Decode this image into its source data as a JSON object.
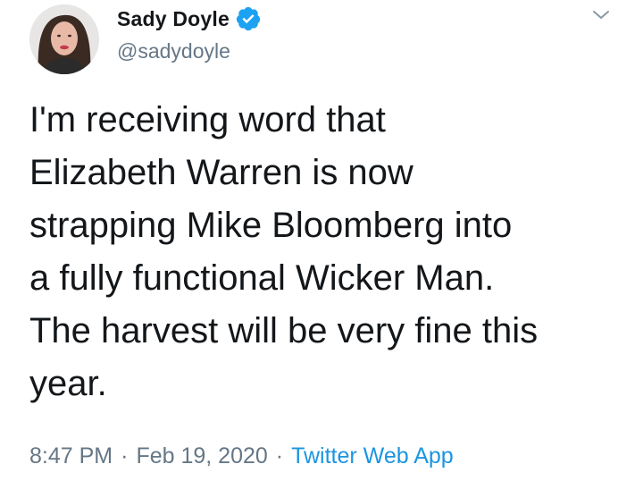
{
  "author": {
    "display_name": "Sady Doyle",
    "handle": "@sadydoyle",
    "verified": true,
    "avatar_icon": "profile-photo"
  },
  "tweet": {
    "text": "I'm receiving word that\nElizabeth Warren is now\nstrapping Mike Bloomberg into\na fully functional Wicker Man.\nThe harvest will be very fine this\nyear."
  },
  "meta": {
    "time": "8:47 PM",
    "separator": "·",
    "date": "Feb 19, 2020",
    "source": "Twitter Web App"
  },
  "icons": {
    "verified": "verified-badge-icon",
    "menu": "chevron-down-icon"
  },
  "colors": {
    "text": "#14171a",
    "secondary": "#657786",
    "accent": "#1b95e0",
    "verified": "#1da1f2"
  }
}
